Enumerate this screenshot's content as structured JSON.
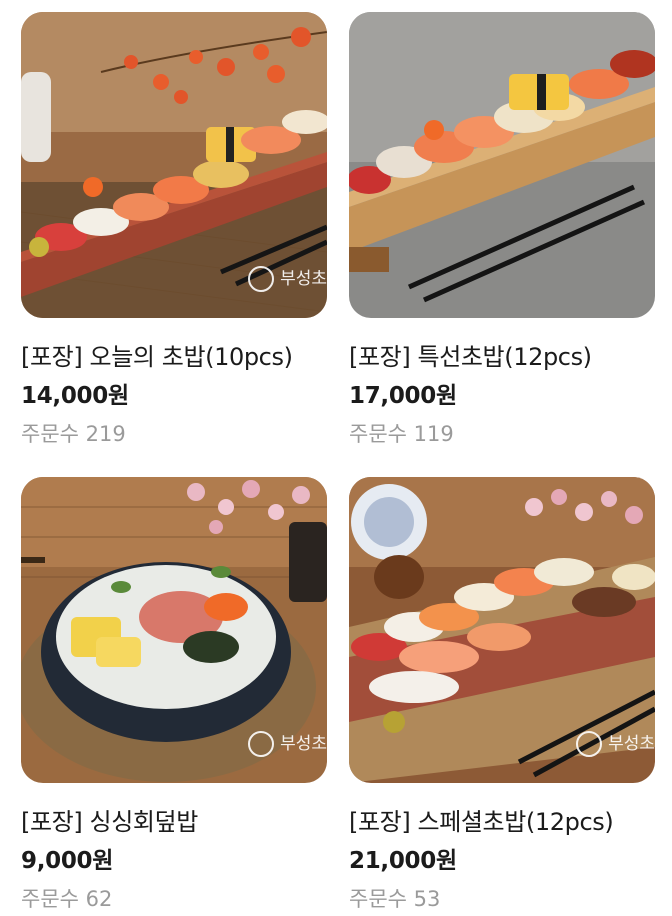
{
  "brand": {
    "logo_text": "부성초"
  },
  "products": [
    {
      "name": "[포장] 오늘의 초밥(10pcs)",
      "price": "14,000원",
      "orders": "주문수 219",
      "image_icon": "sushi-platter-image"
    },
    {
      "name": "[포장] 특선초밥(12pcs)",
      "price": "17,000원",
      "orders": "주문수 119",
      "image_icon": "sushi-platter-image"
    },
    {
      "name": "[포장] 싱싱회덮밥",
      "price": "9,000원",
      "orders": "주문수 62",
      "image_icon": "hoedeopbap-bowl-image"
    },
    {
      "name": "[포장] 스페셜초밥(12pcs)",
      "price": "21,000원",
      "orders": "주문수 53",
      "image_icon": "sushi-platter-image"
    }
  ]
}
